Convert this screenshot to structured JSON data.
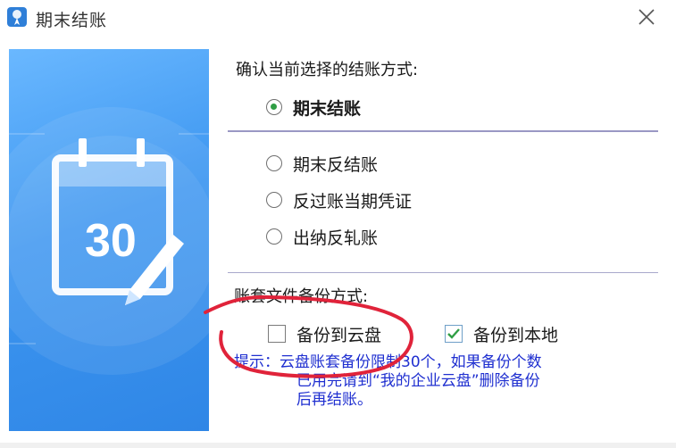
{
  "window": {
    "title": "期末结账",
    "icon": "app-logo-icon",
    "close_icon": "close-icon"
  },
  "banner": {
    "calendar_day": "30",
    "icon": "calendar-edit-icon"
  },
  "settle_mode": {
    "label": "确认当前选择的结账方式:",
    "selected": "期末结账",
    "options": [
      {
        "label": "期末结账",
        "checked": true
      },
      {
        "label": "期末反结账",
        "checked": false
      },
      {
        "label": "反过账当期凭证",
        "checked": false
      },
      {
        "label": "出纳反轧账",
        "checked": false
      }
    ]
  },
  "backup": {
    "label": "账套文件备份方式:",
    "options": [
      {
        "label": "备份到云盘",
        "checked": false
      },
      {
        "label": "备份到本地",
        "checked": true
      }
    ]
  },
  "hint": {
    "line1": "提示：云盘账套备份限制30个，如果备份个数",
    "line2": "已用完请到“我的企业云盘”删除备份",
    "line3": "后再结账。"
  },
  "colors": {
    "hint_text": "#1f2fd0",
    "annotation_circle": "#e0233a",
    "banner_blue": "#3d96f0",
    "radio_dot": "#2f9e44",
    "check_mark": "#2f9e44"
  }
}
